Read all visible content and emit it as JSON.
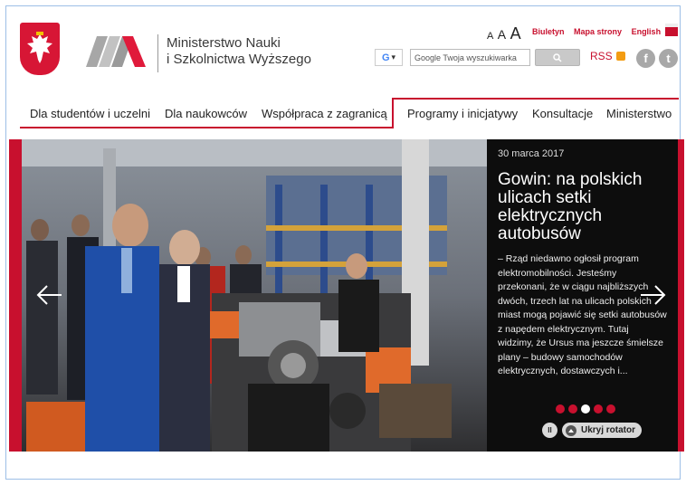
{
  "header": {
    "ministry_line1": "Ministerstwo Nauki",
    "ministry_line2": "i Szkolnictwa Wyższego",
    "font_sizes": [
      "A",
      "A",
      "A"
    ],
    "top_links": [
      "Biuletyn",
      "Mapa strony",
      "English"
    ],
    "search": {
      "engine_label": "G",
      "engine_caret": "▾",
      "placeholder": "Google Twoja wyszukiwarka"
    },
    "rss_label": "RSS",
    "social": [
      "f",
      "t"
    ]
  },
  "nav": {
    "items": [
      "Dla studentów i uczelni",
      "Dla naukowców",
      "Współpraca z zagranicą",
      "Programy i inicjatywy",
      "Konsultacje",
      "Ministerstwo"
    ]
  },
  "slider": {
    "date": "30 marca 2017",
    "title": "Gowin: na polskich ulicach setki elektrycznych autobusów",
    "text": "– Rząd niedawno ogłosił program elektromobilności. Jesteśmy przekonani, że w ciągu najbliższych dwóch, trzech lat na ulicach polskich miast mogą pojawić się setki autobusów z napędem elektrycznym. Tutaj widzimy, że Ursus ma jeszcze śmielsze plany – budowy samochodów elektrycznych, dostawczych i...",
    "dots": 5,
    "active_dot": 3,
    "pause_label": "II",
    "hide_label": "Ukryj rotator"
  },
  "colors": {
    "accent": "#c8102e",
    "caption_bg": "#0d0d0d"
  }
}
